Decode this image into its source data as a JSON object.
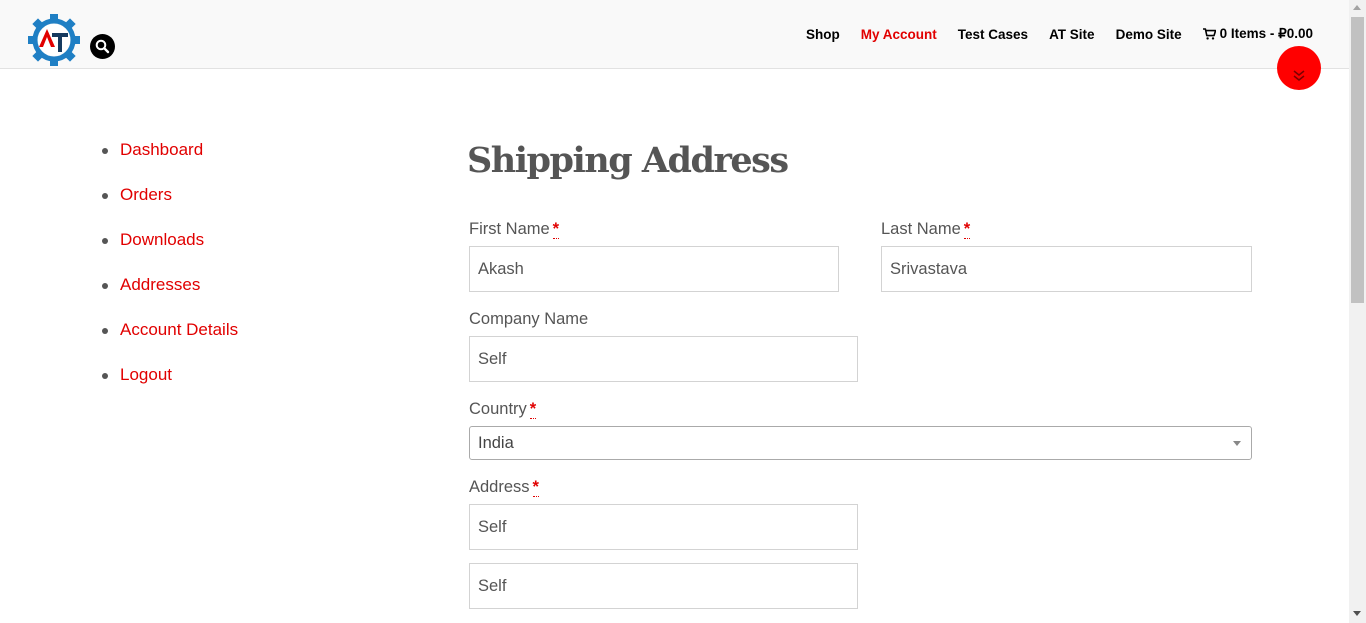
{
  "header": {
    "nav": [
      "Shop",
      "My Account",
      "Test Cases",
      "AT Site",
      "Demo Site"
    ],
    "active_nav": "My Account",
    "cart_label": "0 Items - ₽0.00",
    "logo_letters": "AT",
    "accent_color": "#e10000"
  },
  "sidebar": {
    "items": [
      "Dashboard",
      "Orders",
      "Downloads",
      "Addresses",
      "Account Details",
      "Logout"
    ]
  },
  "form": {
    "title": "Shipping Address",
    "required_mark": "*",
    "first_name": {
      "label": "First Name",
      "value": "Akash"
    },
    "last_name": {
      "label": "Last Name",
      "value": "Srivastava"
    },
    "company": {
      "label": "Company Name",
      "value": "Self"
    },
    "country": {
      "label": "Country",
      "value": "India"
    },
    "address": {
      "label": "Address",
      "line1": "Self",
      "line2": "Self"
    }
  },
  "icons": {
    "search": "search-icon",
    "cart": "cart-icon",
    "scroll": "chevron-double-down-icon"
  }
}
